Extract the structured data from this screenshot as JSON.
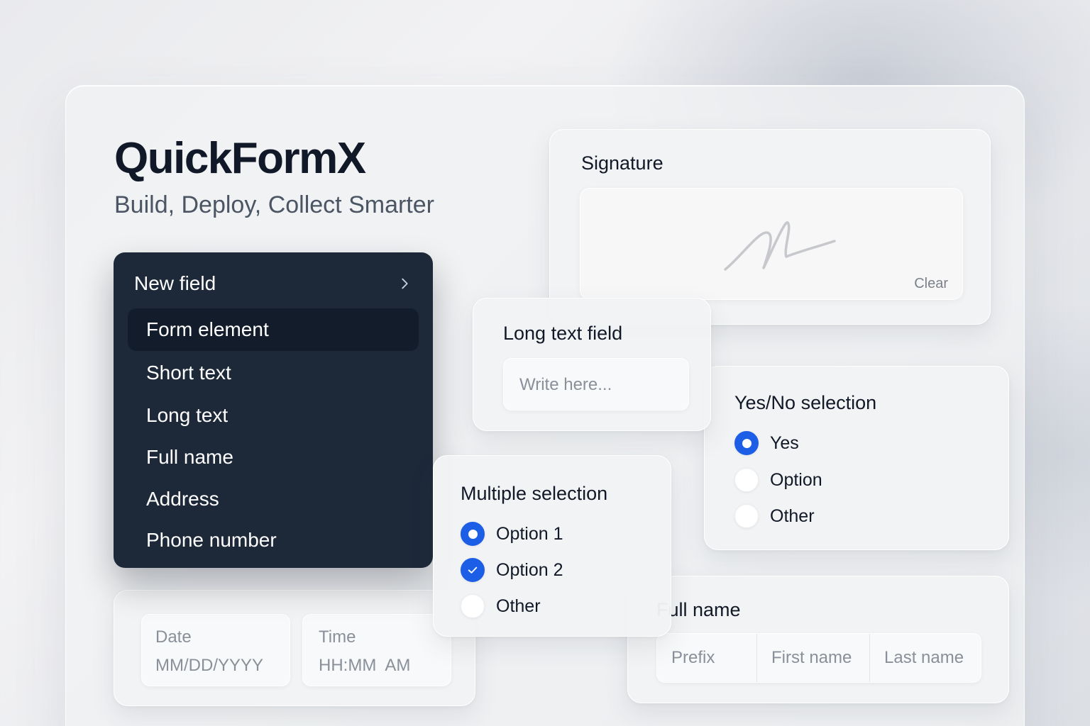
{
  "brand": {
    "title": "QuickFormX",
    "subtitle": "Build, Deploy, Collect Smarter"
  },
  "menu": {
    "header": "New field",
    "header_icon": "chevron-right-icon",
    "items": [
      {
        "label": "Form element",
        "active": true
      },
      {
        "label": "Short text"
      },
      {
        "label": "Long text"
      },
      {
        "label": "Full name"
      },
      {
        "label": "Address"
      },
      {
        "label": "Phone number"
      }
    ]
  },
  "signature": {
    "title": "Signature",
    "clear_label": "Clear"
  },
  "long_text": {
    "title": "Long text field",
    "placeholder": "Write here..."
  },
  "yes_no": {
    "title": "Yes/No selection",
    "options": [
      {
        "label": "Yes",
        "selected": true
      },
      {
        "label": "Option",
        "selected": false
      },
      {
        "label": "Other",
        "selected": false
      }
    ]
  },
  "multi": {
    "title": "Multiple selection",
    "options": [
      {
        "label": "Option 1",
        "state": "radio-selected"
      },
      {
        "label": "Option 2",
        "state": "checked"
      },
      {
        "label": "Other",
        "state": "unselected"
      }
    ]
  },
  "datetime": {
    "date_label": "Date",
    "date_placeholder": "MM/DD/YYYY",
    "time_label": "Time",
    "time_placeholder": "HH:MM  AM"
  },
  "full_name": {
    "title": "Full name",
    "prefix": "Prefix",
    "first": "First name",
    "last": "Last name"
  },
  "colors": {
    "accent": "#1d5ee6",
    "menu_bg": "#1d2939",
    "menu_active": "#121c2b"
  }
}
